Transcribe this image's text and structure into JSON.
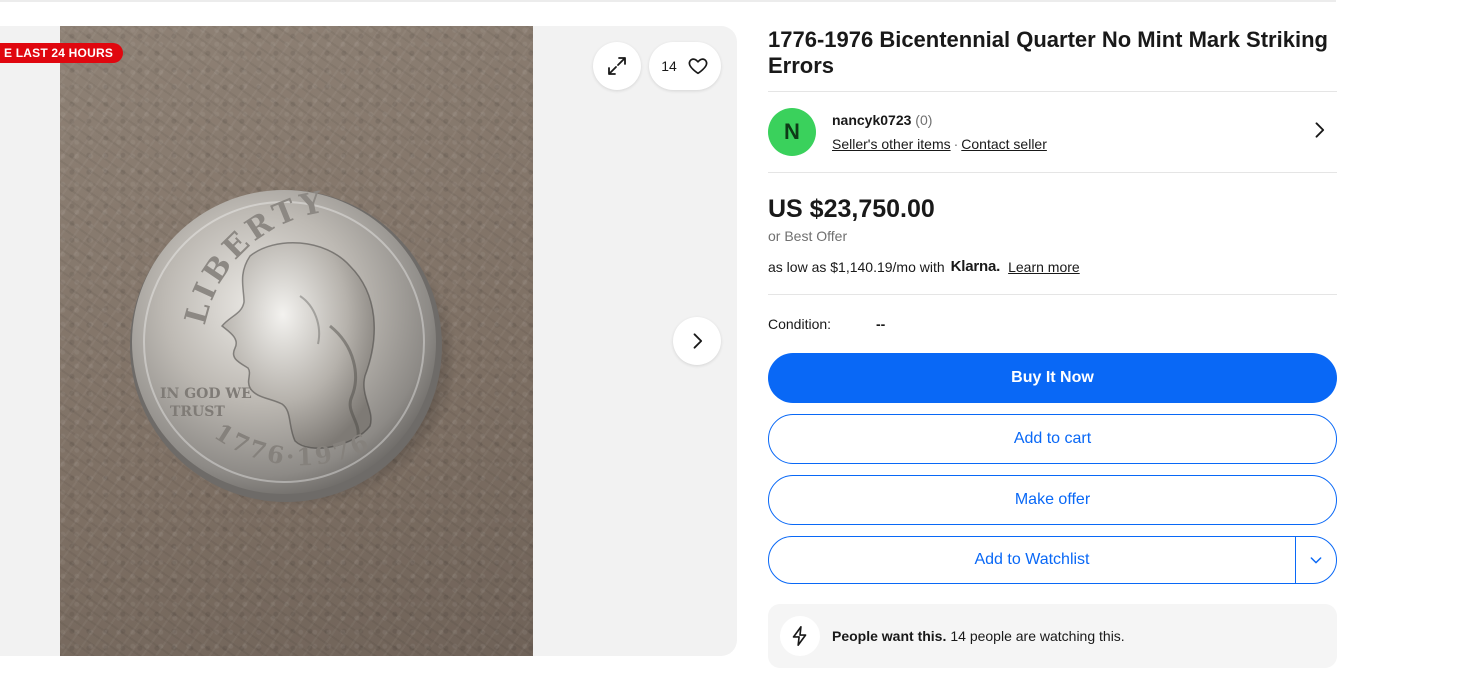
{
  "gallery": {
    "badge": "E LAST 24 HOURS",
    "watch_count": "14",
    "coin_legend_top": "LIBERTY",
    "coin_motto": [
      "IN GOD WE",
      "TRUST"
    ],
    "coin_date": "1776·1976",
    "icons": {
      "expand": "expand-icon",
      "heart": "heart-icon",
      "next": "chevron-right-icon"
    }
  },
  "listing": {
    "title": "1776-1976 Bicentennial Quarter No Mint Mark Striking Errors",
    "seller": {
      "avatar_letter": "N",
      "avatar_color": "#3ad15c",
      "name": "nancyk0723",
      "feedback": "(0)",
      "other_items": "Seller's other items",
      "separator": "·",
      "contact": "Contact seller"
    },
    "price": "US $23,750.00",
    "best_offer": "or Best Offer",
    "klarna": {
      "text": "as low as $1,140.19/mo with",
      "brand": "Klarna.",
      "learn_more": "Learn more"
    },
    "condition": {
      "label": "Condition:",
      "value": "--"
    },
    "buttons": {
      "buy_now": "Buy It Now",
      "add_to_cart": "Add to cart",
      "make_offer": "Make offer",
      "add_to_watchlist": "Add to Watchlist"
    },
    "signal": {
      "bold": "People want this.",
      "text": "14 people are watching this."
    },
    "colors": {
      "primary": "#0968f6",
      "badge_red": "#e0070f"
    }
  }
}
